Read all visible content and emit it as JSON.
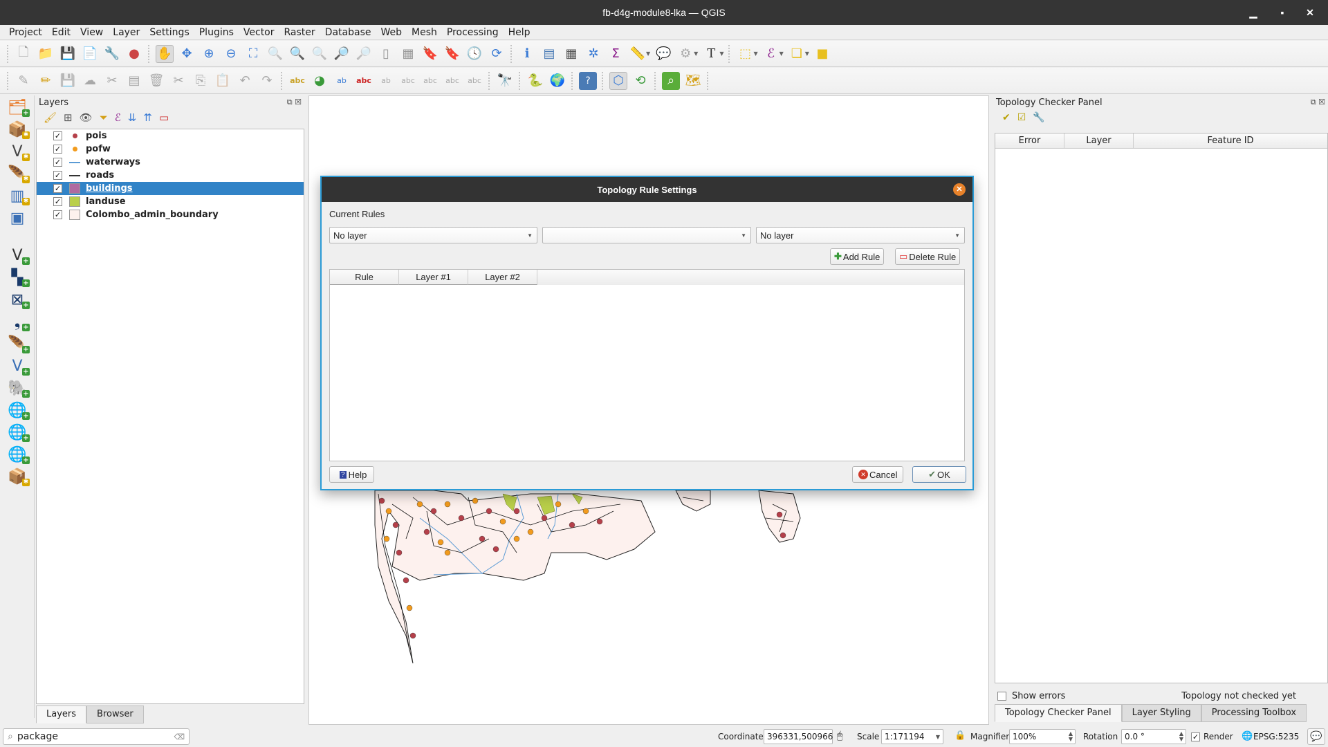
{
  "window": {
    "title": "fb-d4g-module8-lka — QGIS",
    "controls": [
      "minimize",
      "maximize",
      "close"
    ]
  },
  "menubar": [
    "Project",
    "Edit",
    "View",
    "Layer",
    "Settings",
    "Plugins",
    "Vector",
    "Raster",
    "Database",
    "Web",
    "Mesh",
    "Processing",
    "Help"
  ],
  "layers_panel": {
    "title": "Layers",
    "layers": [
      {
        "name": "pois",
        "checked": true,
        "symbol": "point",
        "color": "#b5404a",
        "selected": false
      },
      {
        "name": "pofw",
        "checked": true,
        "symbol": "point",
        "color": "#f29b1d",
        "selected": false
      },
      {
        "name": "waterways",
        "checked": true,
        "symbol": "line",
        "color": "#5b9bd5",
        "selected": false
      },
      {
        "name": "roads",
        "checked": true,
        "symbol": "line",
        "color": "#333333",
        "selected": false
      },
      {
        "name": "buildings",
        "checked": true,
        "symbol": "fill",
        "color": "#b06aa0",
        "selected": true
      },
      {
        "name": "landuse",
        "checked": true,
        "symbol": "fill",
        "color": "#b9cf4a",
        "selected": false
      },
      {
        "name": "Colombo_admin_boundary",
        "checked": true,
        "symbol": "fill",
        "color": "#fdf1ee",
        "selected": false
      }
    ],
    "tabs": [
      "Layers",
      "Browser"
    ],
    "active_tab": "Layers"
  },
  "dialog": {
    "title": "Topology Rule Settings",
    "current_rules_label": "Current Rules",
    "layer1_combo": "No layer",
    "rule_combo": "",
    "layer2_combo": "No layer",
    "add_rule": "Add Rule",
    "delete_rule": "Delete Rule",
    "columns": [
      "Rule",
      "Layer #1",
      "Layer #2"
    ],
    "rows": [],
    "help": "Help",
    "cancel": "Cancel",
    "ok": "OK"
  },
  "topology_panel": {
    "title": "Topology Checker Panel",
    "columns": [
      "Error",
      "Layer",
      "Feature ID"
    ],
    "rows": [],
    "show_errors_label": "Show errors",
    "show_errors_checked": false,
    "status": "Topology not checked yet",
    "tabs": [
      "Topology Checker Panel",
      "Layer Styling",
      "Processing Toolbox"
    ],
    "active_tab": "Topology Checker Panel"
  },
  "statusbar": {
    "locator_value": "package",
    "coordinate_label": "Coordinate",
    "coordinate": "396331,500966",
    "scale_label": "Scale",
    "scale": "1:171194",
    "magnifier_label": "Magnifier",
    "magnifier": "100%",
    "rotation_label": "Rotation",
    "rotation": "0.0 °",
    "render_label": "Render",
    "render_checked": true,
    "crs": "EPSG:5235"
  },
  "colors": {
    "accent": "#2a9bd6",
    "selection": "#3183c7",
    "titlebar": "#353535"
  }
}
